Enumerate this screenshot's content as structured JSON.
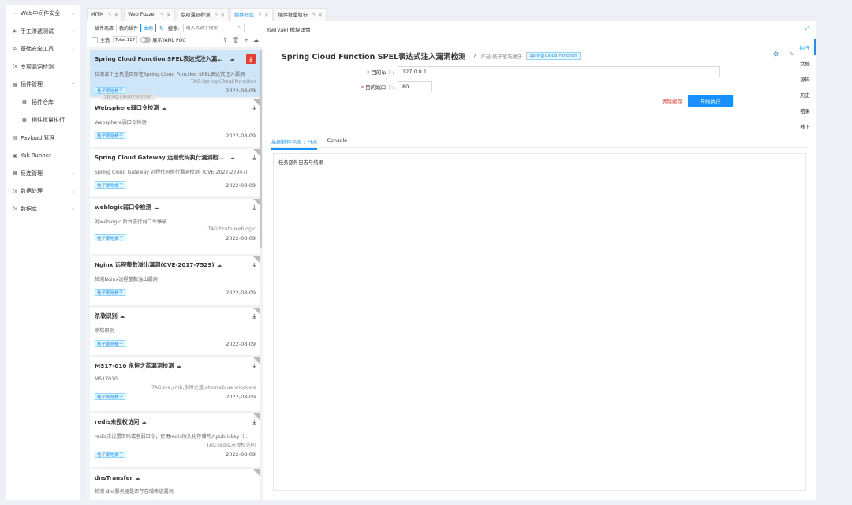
{
  "sidebar": {
    "items": [
      {
        "icon": "ellipsis-icon",
        "glyph": "⋯",
        "label": "Web中间件安全",
        "chevron": "⌄"
      },
      {
        "icon": "target-icon",
        "glyph": "◈",
        "label": "手工渗透测试",
        "chevron": "⌄"
      },
      {
        "icon": "aim-icon",
        "glyph": "⊕",
        "label": "基础安全工具",
        "chevron": "⌄"
      },
      {
        "icon": "function-icon",
        "glyph": "ƒx",
        "label": "专项漏洞检测",
        "chevron": ""
      },
      {
        "icon": "appstore-icon",
        "glyph": "▦",
        "label": "插件管理",
        "chevron": "⌃"
      }
    ],
    "sub_items": [
      {
        "icon": "appstore-icon",
        "glyph": "▦",
        "label": "插件仓库"
      },
      {
        "icon": "appstore-icon",
        "glyph": "▦",
        "label": "插件批量执行"
      }
    ],
    "items2": [
      {
        "icon": "database-icon",
        "glyph": "▤",
        "label": "Payload 管理",
        "chevron": ""
      },
      {
        "icon": "code-icon",
        "glyph": "▣",
        "label": "Yak Runner",
        "chevron": ""
      },
      {
        "icon": "appstore-icon",
        "glyph": "▦",
        "label": "反连管理",
        "chevron": "⌄"
      },
      {
        "icon": "function-icon",
        "glyph": "ƒx",
        "label": "数据处理",
        "chevron": "⌄"
      },
      {
        "icon": "function-icon",
        "glyph": "ƒx",
        "label": "数据库",
        "chevron": "⌄"
      }
    ]
  },
  "tabs": [
    {
      "label": "MITM",
      "active": false
    },
    {
      "label": "Web Fuzzer",
      "active": false
    },
    {
      "label": "专项漏洞检测",
      "active": false
    },
    {
      "label": "插件仓库",
      "active": true
    },
    {
      "label": "插件批量执行",
      "active": false
    }
  ],
  "plugin_list": {
    "seg": [
      "插件商店",
      "我的插件",
      "本地"
    ],
    "search_label": "搜索:",
    "search_placeholder": "输入关键字搜索",
    "select_all": "全选",
    "total": "Total:117",
    "yaml_toggle": "展示YAML POC",
    "tooltip": "Spring Cloud Function",
    "cards": [
      {
        "title": "Spring Cloud Function SPEL表达式注入漏洞检测",
        "desc": "检测单个主机是否存在Spring Cloud Function SPEL表达式注入漏洞",
        "tag": "TAG:Spring Cloud Function",
        "author": "桔子爱吃橘子",
        "date": "2022-08-09",
        "selected": true
      },
      {
        "title": "Websphere弱口令检测",
        "desc": "Websphere弱口令检测",
        "tag": "",
        "author": "桔子爱吃橘子",
        "date": "2022-08-09",
        "selected": false
      },
      {
        "title": "Spring Cloud Gateway 远程代码执行漏洞检测（C...",
        "desc": "Spring Cloud Gateway 远程代码执行漏洞检测（CVE-2022-22947)",
        "tag": "",
        "author": "桔子爱吃橘子",
        "date": "2022-08-09",
        "selected": false
      },
      {
        "title": "weblogic弱口令检测",
        "desc": "对weblogic 后台进行弱口令爆破",
        "tag": "TAG:brute,weblogic",
        "author": "桔子爱吃橘子",
        "date": "2022-08-09",
        "selected": false
      },
      {
        "title": "Nginx 远程整数溢出漏洞(CVE-2017-7529)",
        "desc": "检测Nginx远程整数溢出漏洞",
        "tag": "",
        "author": "桔子爱吃橘子",
        "date": "2022-08-09",
        "selected": false
      },
      {
        "title": "杀软识别",
        "desc": "杀软识别",
        "tag": "",
        "author": "桔子爱吃橘子",
        "date": "2022-08-09",
        "selected": false
      },
      {
        "title": "MS17-010 永恒之蓝漏洞检测",
        "desc": "MS17010",
        "tag": "TAG:rce,smb,永恒之蓝,eternalblue,windows",
        "author": "桔子爱吃橘子",
        "date": "2022-08-09",
        "selected": false
      },
      {
        "title": "redis未授权访问",
        "desc": "redis未设置密码或者弱口令，使用redis持久化存储写入publickey（...",
        "tag": "TAG:redis,未授权访问",
        "author": "桔子爱吃橘子",
        "date": "2022-08-09",
        "selected": false
      },
      {
        "title": "dnsTransfer",
        "desc": "检测 dns服务器是否存在域传送漏洞",
        "tag": "",
        "author": "",
        "date": "",
        "selected": false
      }
    ]
  },
  "detail": {
    "subtitle": "Yak[yak] 模块详情",
    "title": "Spring Cloud Function SPEL表达式注入漏洞检测",
    "author_label": "作者:桔子爱吃橘子",
    "tag": "Spring Cloud Function",
    "fields": [
      {
        "label": "目的ip",
        "value": "127.0.0.1"
      },
      {
        "label": "目的端口",
        "value": "80"
      }
    ],
    "clear_label": "清除缓存",
    "run_label": "开始执行",
    "inner_tabs": [
      "基础插件信息 / 日志",
      "Console"
    ],
    "log_header": "任务额外日志与结果",
    "side_tabs": [
      "执行",
      "文档",
      "源码",
      "历史",
      "结果",
      "线上"
    ]
  },
  "colors": {
    "accent": "#1890ff",
    "danger": "#e83e2f",
    "selected": "#cfe6f8"
  }
}
